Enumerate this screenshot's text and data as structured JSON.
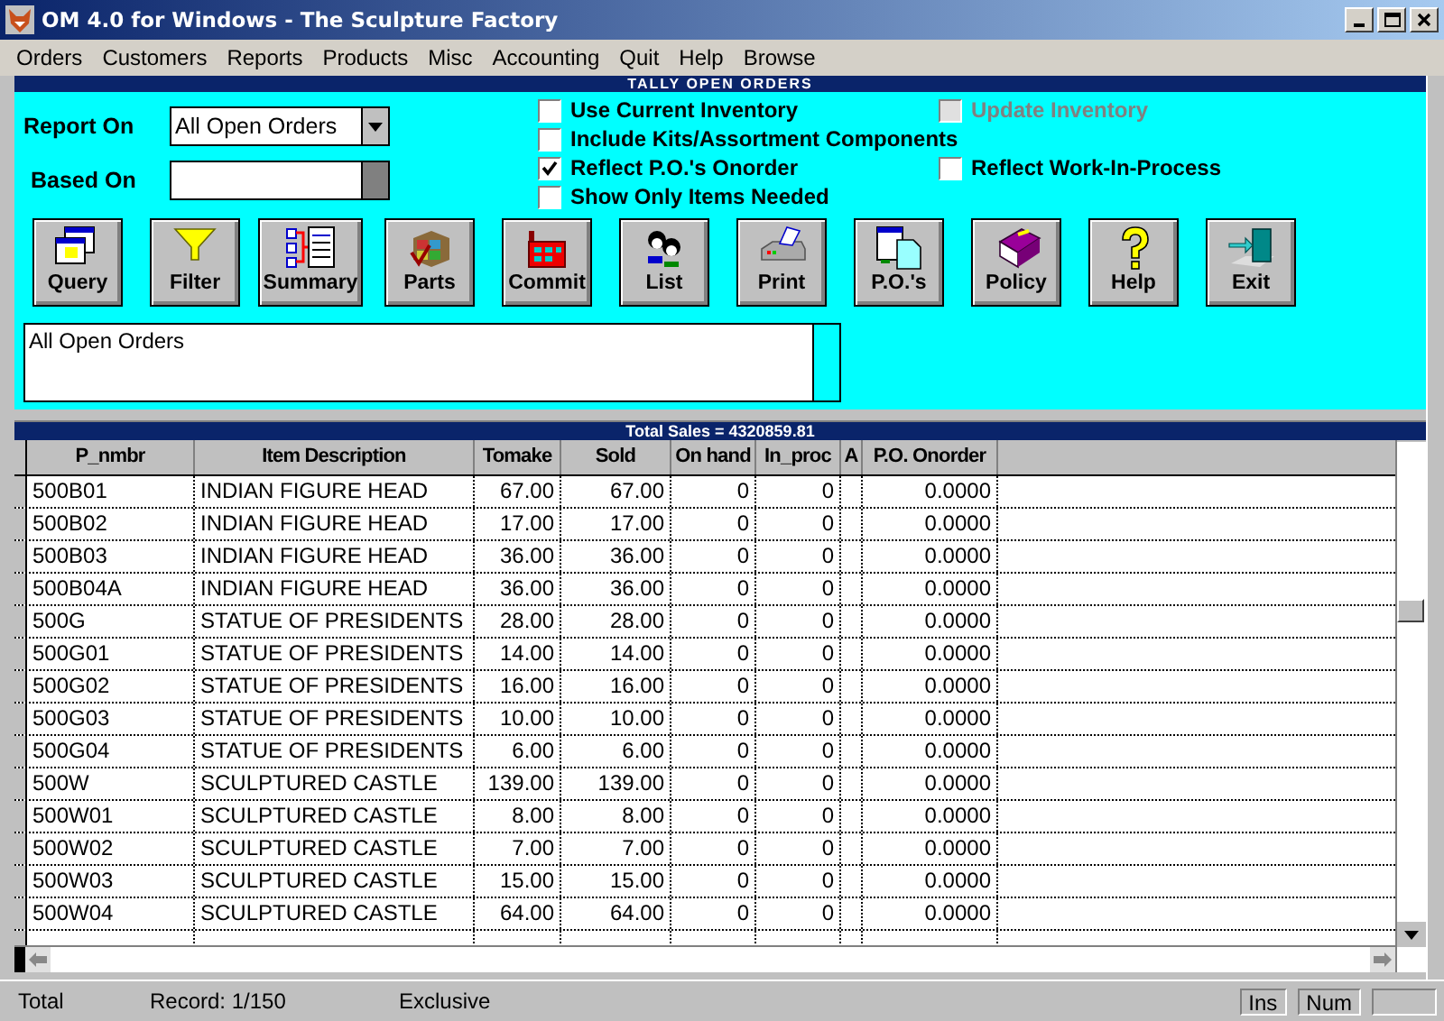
{
  "window": {
    "title": "OM 4.0 for Windows - The Sculpture Factory"
  },
  "menu": [
    "Orders",
    "Customers",
    "Reports",
    "Products",
    "Misc",
    "Accounting",
    "Quit",
    "Help",
    "Browse"
  ],
  "form": {
    "title": "TALLY OPEN ORDERS",
    "report_on": {
      "label": "Report On",
      "value": "All Open Orders"
    },
    "based_on": {
      "label": "Based On"
    },
    "options": [
      {
        "label": "Use Current Inventory",
        "checked": false,
        "disabled": false
      },
      {
        "label": "Update Inventory",
        "checked": false,
        "disabled": true
      },
      {
        "label": "Include Kits/Assortment Components",
        "checked": false,
        "disabled": false
      },
      {
        "label": "Reflect P.O.'s Onorder",
        "checked": true,
        "disabled": false
      },
      {
        "label": "Reflect Work-In-Process",
        "checked": false,
        "disabled": false
      },
      {
        "label": "Show Only Items Needed",
        "checked": false,
        "disabled": false
      }
    ],
    "buttons": [
      "Query",
      "Filter",
      "Summary",
      "Parts",
      "Commit",
      "List",
      "Print",
      "P.O.'s",
      "Policy",
      "Help",
      "Exit"
    ],
    "description": "All Open Orders"
  },
  "table": {
    "title": "Total Sales = 4320859.81",
    "columns": [
      "P_nmbr",
      "Item Description",
      "Tomake",
      "Sold",
      "On hand",
      "In_proc",
      "A",
      "P.O. Onorder"
    ],
    "rows": [
      [
        "500B01",
        "INDIAN FIGURE HEAD",
        "67.00",
        "67.00",
        "0",
        "0",
        "",
        "0.0000"
      ],
      [
        "500B02",
        "INDIAN FIGURE HEAD",
        "17.00",
        "17.00",
        "0",
        "0",
        "",
        "0.0000"
      ],
      [
        "500B03",
        "INDIAN FIGURE HEAD",
        "36.00",
        "36.00",
        "0",
        "0",
        "",
        "0.0000"
      ],
      [
        "500B04A",
        "INDIAN FIGURE HEAD",
        "36.00",
        "36.00",
        "0",
        "0",
        "",
        "0.0000"
      ],
      [
        "500G",
        "STATUE OF PRESIDENTS",
        "28.00",
        "28.00",
        "0",
        "0",
        "",
        "0.0000"
      ],
      [
        "500G01",
        "STATUE OF PRESIDENTS",
        "14.00",
        "14.00",
        "0",
        "0",
        "",
        "0.0000"
      ],
      [
        "500G02",
        "STATUE OF PRESIDENTS",
        "16.00",
        "16.00",
        "0",
        "0",
        "",
        "0.0000"
      ],
      [
        "500G03",
        "STATUE OF PRESIDENTS",
        "10.00",
        "10.00",
        "0",
        "0",
        "",
        "0.0000"
      ],
      [
        "500G04",
        "STATUE OF PRESIDENTS",
        "6.00",
        "6.00",
        "0",
        "0",
        "",
        "0.0000"
      ],
      [
        "500W",
        "SCULPTURED CASTLE",
        "139.00",
        "139.00",
        "0",
        "0",
        "",
        "0.0000"
      ],
      [
        "500W01",
        "SCULPTURED CASTLE",
        "8.00",
        "8.00",
        "0",
        "0",
        "",
        "0.0000"
      ],
      [
        "500W02",
        "SCULPTURED CASTLE",
        "7.00",
        "7.00",
        "0",
        "0",
        "",
        "0.0000"
      ],
      [
        "500W03",
        "SCULPTURED CASTLE",
        "15.00",
        "15.00",
        "0",
        "0",
        "",
        "0.0000"
      ],
      [
        "500W04",
        "SCULPTURED CASTLE",
        "64.00",
        "64.00",
        "0",
        "0",
        "",
        "0.0000"
      ]
    ]
  },
  "status_bar": {
    "panels": [
      "Total",
      "Record: 1/150",
      "Exclusive"
    ],
    "indicators": [
      "Ins",
      "Num"
    ]
  }
}
